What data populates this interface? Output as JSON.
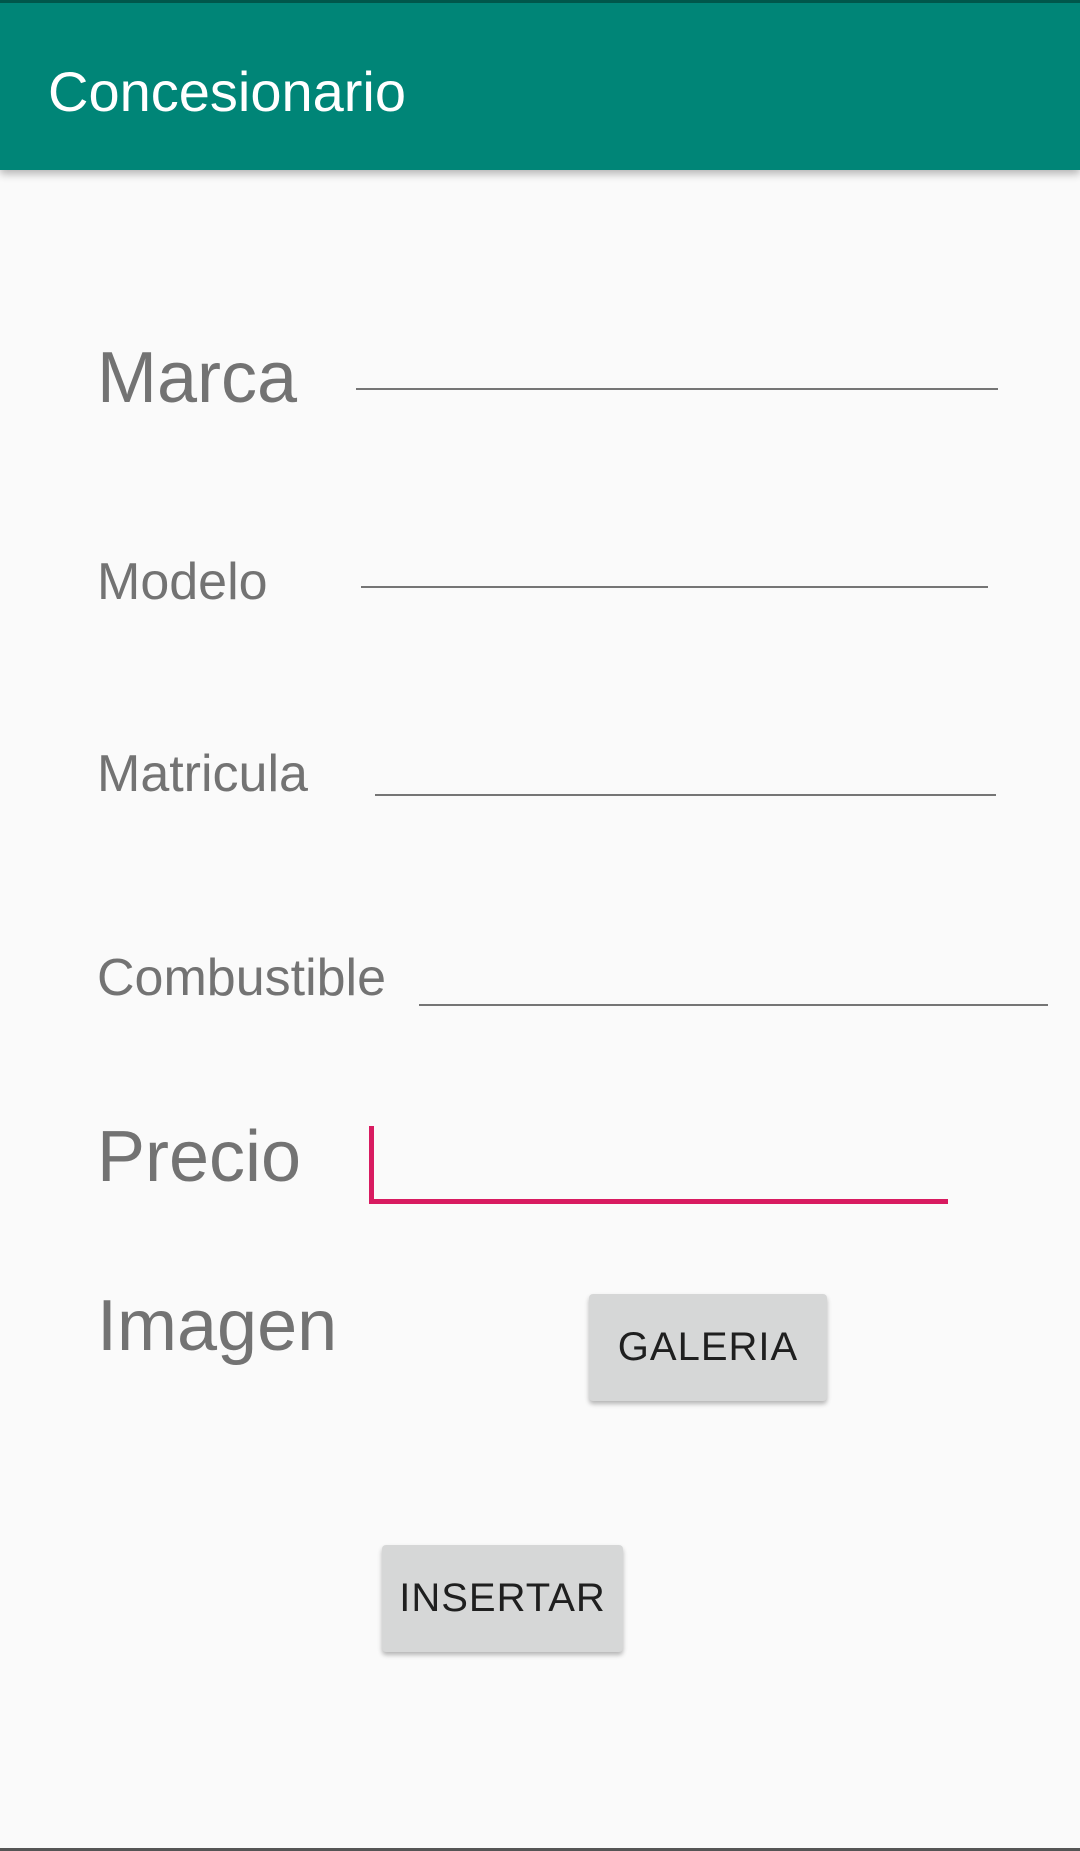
{
  "app_bar": {
    "title": "Concesionario",
    "color": "#008577"
  },
  "form": {
    "fields": [
      {
        "label": "Marca",
        "value": ""
      },
      {
        "label": "Modelo",
        "value": ""
      },
      {
        "label": "Matricula",
        "value": ""
      },
      {
        "label": "Combustible",
        "value": ""
      },
      {
        "label": "Precio",
        "value": "",
        "focused": true
      }
    ],
    "image_label": "Imagen",
    "gallery_button": "GALERIA",
    "insert_button": "INSERTAR"
  },
  "colors": {
    "accent": "#d81b60",
    "background": "#fafafa",
    "button": "#d6d7d7"
  }
}
